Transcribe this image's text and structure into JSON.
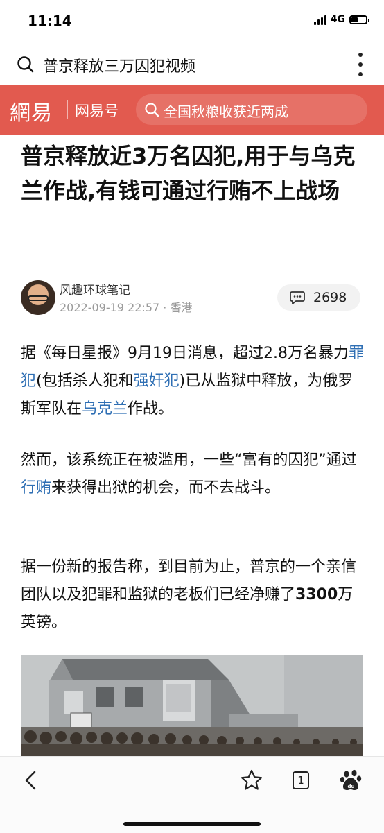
{
  "status_bar": {
    "time": "11:14",
    "network": "4G"
  },
  "search_bar": {
    "query": "普京释放三万囚犯视频",
    "icons": [
      "search-icon",
      "more-icon"
    ]
  },
  "netease_header": {
    "logo": "網易",
    "channel": "网易号",
    "hot_search": "全国秋粮收获近两成",
    "bar_color": "#e25a4f"
  },
  "article": {
    "title": "普京释放近3万名囚犯,用于与乌克兰作战,有钱可通过行贿不上战场",
    "author": "风趣环球笔记",
    "date_location": "2022-09-19 22:57 · 香港",
    "comment_count": "2698",
    "p1": {
      "t1": "据《每日星报》9月19日消息，超过2.8万名暴力",
      "l1": "罪犯",
      "t2": "(包括杀人犯和",
      "l2": "强奸犯",
      "t3": ")已从监狱中释放，为俄罗斯军队在",
      "l3": "乌克兰",
      "t4": "作战。"
    },
    "p2": {
      "t1": "然而，该系统正在被滥用，一些“富有的囚犯”通过",
      "l1": "行贿",
      "t2": "来获得出狱的机会，而不去战斗。"
    },
    "p3": {
      "t1": "据一份新的报告称，到目前为止，普京的一个亲信团队以及犯罪和监狱的老板们已经净赚了",
      "b1": "3300",
      "t2": "万英镑。"
    },
    "link_color": "#2f6fb4"
  },
  "bottom_nav": {
    "tab_count": "1",
    "icons": [
      "back-icon",
      "star-icon",
      "tabs-icon",
      "baidu-paw-icon"
    ]
  }
}
